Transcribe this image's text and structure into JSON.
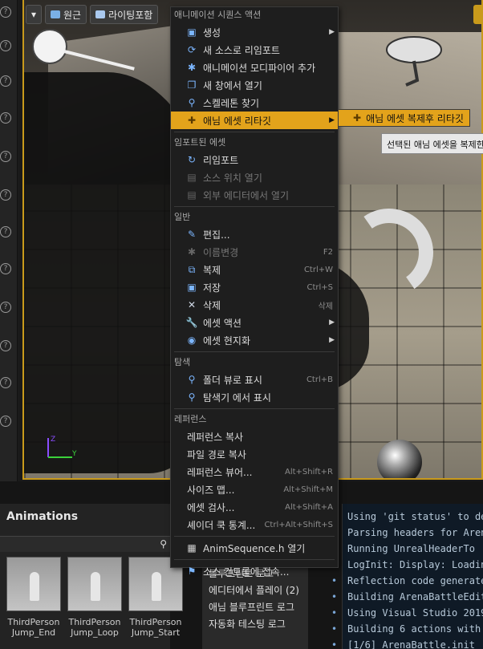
{
  "viewport": {
    "toolbar": {
      "dropdown_icon": "chevron-down-icon",
      "perspective_label": "원근",
      "lighting_label": "라이팅포함"
    }
  },
  "context_menu": {
    "sections": {
      "anim_seq_actions": "애니메이션 시퀀스 액션",
      "imported_asset": "임포트된 에셋",
      "general": "일반",
      "explore": "탐색",
      "references": "레퍼런스"
    },
    "items": {
      "create": "생성",
      "new_source_reimport": "새 소스로 리임포트",
      "add_anim_modifier": "애니메이션 모디파이어 추가",
      "open_new_window": "새 창에서 열기",
      "find_skeleton": "스켈레톤 찾기",
      "retarget_anim_assets": "애님 에셋 리타깃",
      "reimport": "리임포트",
      "open_source_location": "소스 위치 열기",
      "open_external_editor": "외부 에디터에서 열기",
      "edit": "편집...",
      "rename": "이름변경",
      "duplicate": "복제",
      "save": "저장",
      "delete": "삭제",
      "asset_actions": "에셋 액션",
      "asset_localization": "에셋 현지화",
      "show_in_folder_view": "폴더 뷰로 표시",
      "show_in_explorer": "탐색기 에서 표시",
      "copy_reference": "레퍼런스 복사",
      "copy_file_path": "파일 경로 복사",
      "reference_viewer": "레퍼런스 뷰어...",
      "size_map": "사이즈 맵...",
      "audit_assets": "에셋 검사...",
      "shader_cook_stats": "셰이더 쿡 통계...",
      "open_source_header": "AnimSequence.h 열기",
      "source_control": "소스 컨트롤에 접속..."
    },
    "shortcuts": {
      "rename": "F2",
      "duplicate": "Ctrl+W",
      "save": "Ctrl+S",
      "delete": "삭제",
      "show_in_folder_view": "Ctrl+B",
      "reference_viewer": "Alt+Shift+R",
      "size_map": "Alt+Shift+M",
      "audit_assets": "Alt+Shift+A",
      "shader_cook_stats": "Ctrl+Alt+Shift+S"
    }
  },
  "submenu": {
    "duplicate_and_retarget": "애님 에셋 복제후 리타깃"
  },
  "tooltip": {
    "text": "선택된 애님 에셋을 복제한"
  },
  "animations_panel": {
    "title": "Animations",
    "items": [
      {
        "line1": "ThirdPerson",
        "line2": "Jump_End"
      },
      {
        "line1": "ThirdPerson",
        "line2": "Jump_Loop"
      },
      {
        "line1": "ThirdPerson",
        "line2": "Jump_Start"
      }
    ]
  },
  "log_categories": {
    "items": [
      "블루프린트 로그",
      "에디터에서 플레이 (2)",
      "애님 블루프린트 로그",
      "자동화 테스팅 로그"
    ]
  },
  "output_log": {
    "lines": [
      "Using 'git status' to de",
      "Parsing headers for Aren",
      "  Running UnrealHeaderTo",
      "LogInit: Display: Loadin",
      "Reflection code generate",
      "Building ArenaBattleEdit",
      "Using Visual Studio 2019",
      "Building 6 actions with",
      "  [1/6] ArenaBattle.init"
    ]
  }
}
